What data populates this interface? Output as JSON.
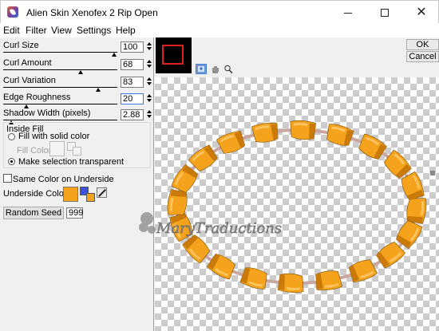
{
  "window": {
    "title": "Alien Skin Xenofex 2 Rip Open"
  },
  "menu": [
    "Edit",
    "Filter",
    "View",
    "Settings",
    "Help"
  ],
  "params": [
    {
      "label": "Curl Size",
      "value": "100",
      "level": 0.97
    },
    {
      "label": "Curl Amount",
      "value": "68",
      "level": 0.68
    },
    {
      "label": "Curl Variation",
      "value": "83",
      "level": 0.83
    },
    {
      "label": "Edge Roughness",
      "value": "20",
      "level": 0.2
    },
    {
      "label": "Shadow Width (pixels)",
      "value": "2.88",
      "level": 0.07
    }
  ],
  "inside_fill": {
    "title": "Inside Fill",
    "option_solid": "Fill with solid color",
    "fill_color_label": "Fill Color",
    "option_transparent": "Make selection transparent",
    "selected": "transparent"
  },
  "underside": {
    "same_color_label": "Same Color on Underside",
    "same_color_checked": false,
    "color_label": "Underside Color",
    "color": "#f5a21c"
  },
  "random_seed": {
    "button_label": "Random Seed",
    "value": "999"
  },
  "buttons": {
    "ok": "OK",
    "cancel": "Cancel"
  },
  "watermark": "MaryTraductions",
  "colors": {
    "accent_blue": "#3d7bd6",
    "curl_orange": "#f5a21c"
  }
}
